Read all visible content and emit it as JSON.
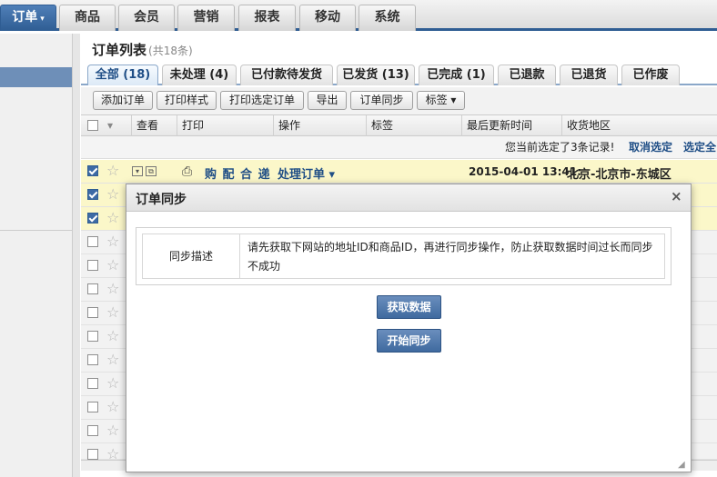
{
  "topnav": {
    "tabs": [
      {
        "label": "订单"
      },
      {
        "label": "商品"
      },
      {
        "label": "会员"
      },
      {
        "label": "营销"
      },
      {
        "label": "报表"
      },
      {
        "label": "移动"
      },
      {
        "label": "系统"
      }
    ],
    "active_caret": "▾"
  },
  "page": {
    "title": "订单列表",
    "count": "(共18条)"
  },
  "status_tabs": [
    {
      "label": "全部 (18)"
    },
    {
      "label": "未处理 (4)"
    },
    {
      "label": "已付款待发货"
    },
    {
      "label": "已发货 (13)"
    },
    {
      "label": "已完成 (1)"
    },
    {
      "label": "已退款"
    },
    {
      "label": "已退货"
    },
    {
      "label": "已作废"
    }
  ],
  "toolbar": {
    "add_order": "添加订单",
    "print_style": "打印样式",
    "print_selected": "打印选定订单",
    "export": "导出",
    "order_sync": "订单同步",
    "tags": "标签 ▾"
  },
  "table": {
    "headers": {
      "view": "查看",
      "print": "打印",
      "operation": "操作",
      "tag": "标签",
      "updated": "最后更新时间",
      "region": "收货地区"
    },
    "sort_caret": "▾"
  },
  "notice": {
    "message": "您当前选定了3条记录!",
    "cancel": "取消选定",
    "select_all": "选定全"
  },
  "first_row": {
    "print_codes": "购 配 合 递",
    "process": "处理订单 ▾",
    "time": "2015-04-01 13:41:",
    "region": "北京-北京市-东城区"
  },
  "row_star": "☆",
  "dialog": {
    "title": "订单同步",
    "close": "×",
    "label": "同步描述",
    "description": "请先获取下网站的地址ID和商品ID，再进行同步操作，防止获取数据时间过长而同步不成功",
    "fetch_button": "获取数据",
    "sync_button": "开始同步"
  }
}
